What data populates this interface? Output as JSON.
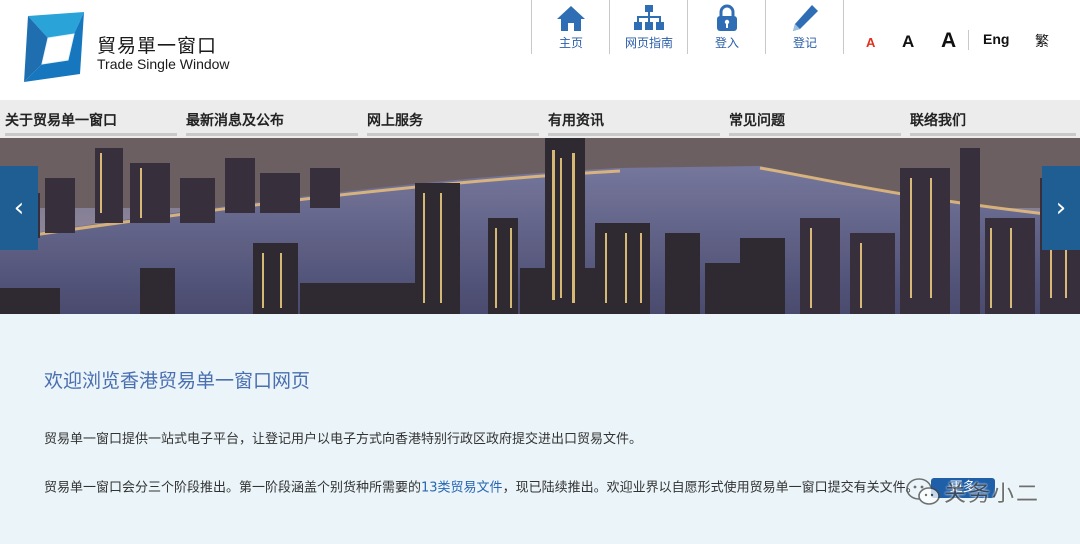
{
  "brand": {
    "name_cn": "貿易單一窗口",
    "name_en": "Trade Single Window"
  },
  "utility_nav": [
    {
      "label": "主页",
      "icon": "home-icon"
    },
    {
      "label": "网页指南",
      "icon": "sitemap-icon"
    },
    {
      "label": "登入",
      "icon": "lock-icon"
    },
    {
      "label": "登记",
      "icon": "pencil-icon"
    }
  ],
  "font_size": {
    "small": "A",
    "medium": "A",
    "large": "A",
    "small_color": "#e0301e"
  },
  "language": {
    "english": "Eng",
    "traditional": "繁"
  },
  "main_nav": [
    "关于贸易单一窗口",
    "最新消息及公布",
    "网上服务",
    "有用资讯",
    "常见问题",
    "联络我们"
  ],
  "banner": {
    "prev_label": "‹",
    "next_label": "›"
  },
  "content": {
    "welcome_title": "欢迎浏览香港贸易单一窗口网页",
    "paragraph1": "贸易单一窗口提供一站式电子平台，让登记用户以电子方式向香港特别行政区政府提交进出口贸易文件。",
    "paragraph2_before": "贸易单一窗口会分三个阶段推出。第一阶段涵盖个别货种所需要的",
    "paragraph2_link": "13类贸易文件",
    "paragraph2_after": "，现已陆续推出。欢迎业界以自愿形式使用贸易单一窗口提交有关文件。",
    "more_button": "更多"
  },
  "watermark": {
    "text": "关务小二"
  },
  "colors": {
    "accent_blue": "#1f5fa8",
    "title_blue": "#4a6fb0",
    "content_bg": "#eaf4f9",
    "nav_bg": "#ececec"
  }
}
